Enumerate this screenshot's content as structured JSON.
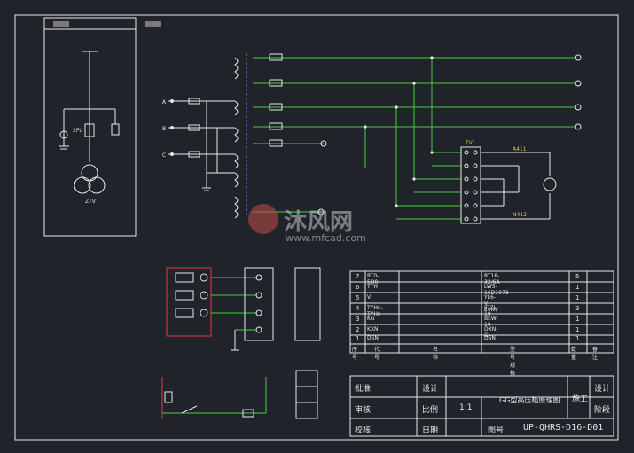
{
  "header_boxes": [
    "",
    ""
  ],
  "phases": [
    "A",
    "B",
    "C"
  ],
  "left_panel": {
    "fuse_label": "2FU",
    "transformer_label": "ZTV"
  },
  "terminal_block_label": "TV1",
  "meter_block": {
    "r1": "A411",
    "r2": "N412"
  },
  "watermark": {
    "brand": "沐风网",
    "url": "www.mfcad.com"
  },
  "bom": {
    "headers": [
      "序号",
      "代 号",
      "名 称",
      "型 号 规 格",
      "数量",
      "备 注"
    ],
    "rows": [
      [
        "7",
        "RT0-5D0",
        "",
        "RT18-32/6A",
        "5",
        ""
      ],
      [
        "6",
        "TYH",
        "",
        "LW5-16D1073",
        "1",
        ""
      ],
      [
        "5",
        "V",
        "",
        "YL6-V 10KV",
        "1",
        ""
      ],
      [
        "4",
        "TYHn-TYHc",
        "",
        "JDZJ-10",
        "3",
        ""
      ],
      [
        "3",
        "KG",
        "",
        "BEW-10",
        "1",
        ""
      ],
      [
        "2",
        "KXN",
        "",
        "DXN-G",
        "1",
        ""
      ],
      [
        "1",
        "DSN",
        "",
        "DSN",
        "1",
        ""
      ]
    ]
  },
  "title_block": {
    "approve": "批准",
    "design": "设计",
    "review": "审核",
    "scale_label": "比例",
    "scale_value": "1:1",
    "drawing_title": "GG型高压柜原理图",
    "stage": "施工",
    "design2": "设计",
    "check": "阶段",
    "proof": "校核",
    "date": "日期",
    "drawing_no_label": "图号",
    "drawing_no": "UP-QHRS-D16-D01"
  }
}
